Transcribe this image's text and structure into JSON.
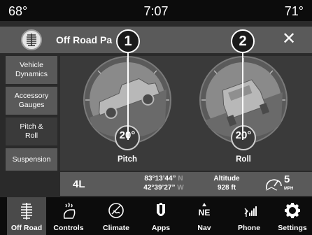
{
  "status": {
    "outside_temp": "68°",
    "time": "7:07",
    "inside_temp": "71°"
  },
  "header": {
    "title": "Off Road Pa"
  },
  "sidebar": {
    "items": [
      {
        "label": "Vehicle Dynamics"
      },
      {
        "label": "Accessory Gauges"
      },
      {
        "label": "Pitch & Roll"
      },
      {
        "label": "Suspension"
      }
    ]
  },
  "gauges": {
    "pitch": {
      "value": "20°",
      "label": "Pitch",
      "callout": "1"
    },
    "roll": {
      "value": "20°",
      "label": "Roll",
      "callout": "2"
    }
  },
  "info": {
    "range": "4L",
    "lon_value": "83°13’44”",
    "lon_dir": "N",
    "lat_value": "42°39’27”",
    "lat_dir": "W",
    "altitude_label": "Altitude",
    "altitude_value": "928 ft",
    "speed": "5",
    "speed_unit": "MPH"
  },
  "nav": {
    "items": [
      {
        "label": "Off Road",
        "icon": "off-road-icon"
      },
      {
        "label": "Controls",
        "icon": "controls-icon"
      },
      {
        "label": "Climate",
        "icon": "climate-icon"
      },
      {
        "label": "Apps",
        "icon": "apps-icon"
      },
      {
        "label": "Nav",
        "icon": "compass-icon",
        "compass": "NE"
      },
      {
        "label": "Phone",
        "icon": "phone-icon"
      },
      {
        "label": "Settings",
        "icon": "gear-icon"
      }
    ]
  }
}
